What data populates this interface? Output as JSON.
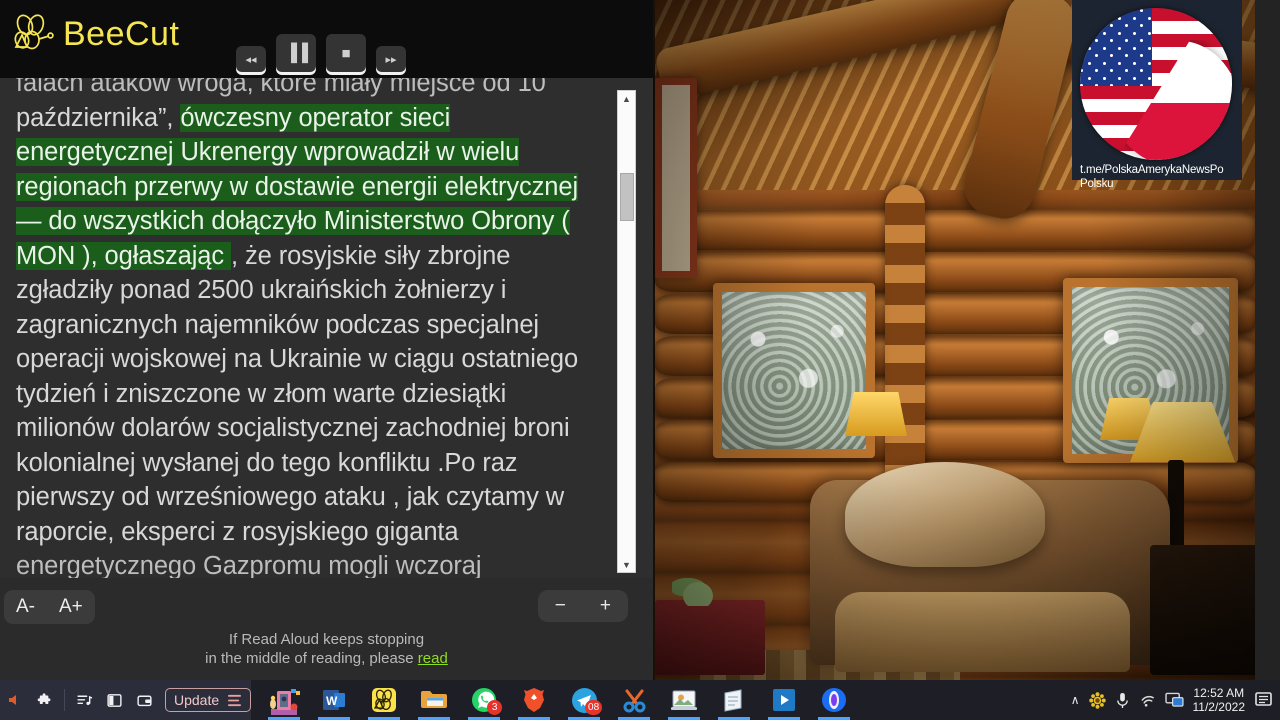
{
  "app": {
    "name": "BeeCut",
    "logo_color": "#f6e552",
    "panel_bg": "#2b2b2b"
  },
  "media_controls": [
    {
      "name": "rewind",
      "glyph": "◂◂",
      "size": "small"
    },
    {
      "name": "pause",
      "glyph": "▐▐",
      "size": "big"
    },
    {
      "name": "stop",
      "glyph": "■",
      "size": "big"
    },
    {
      "name": "forward",
      "glyph": "▸▸",
      "size": "small"
    }
  ],
  "reader": {
    "highlight_color": "#1b5e1b",
    "lines": [
      {
        "text": "falach ataków wroga, które miały miejsce od 10",
        "highlight": "none",
        "clipped": true
      },
      {
        "text": "października”, ",
        "highlight": "none",
        "tail": "ówczesny operator sieci",
        "tail_highlight": "full"
      },
      {
        "text": "energetycznej Ukrenergy wprowadził w wielu",
        "highlight": "full"
      },
      {
        "text": "regionach przerwy w dostawie energii elektrycznej",
        "highlight": "full"
      },
      {
        "text": "— do wszystkich dołączyło Ministerstwo Obrony (",
        "highlight": "full"
      },
      {
        "text": "MON ), ogłaszając ",
        "highlight": "partial",
        "tail": ", że rosyjskie siły zbrojne"
      },
      {
        "text": "zgładziły ponad 2500 ukraińskich żołnierzy i",
        "highlight": "none"
      },
      {
        "text": "zagranicznych najemników podczas specjalnej",
        "highlight": "none"
      },
      {
        "text": "operacji wojskowej na Ukrainie w ciągu ostatniego",
        "highlight": "none"
      },
      {
        "text": "tydzień i zniszczone w złom warte dziesiątki",
        "highlight": "none"
      },
      {
        "text": "milionów dolarów socjalistycznej zachodniej broni",
        "highlight": "none"
      },
      {
        "text": "kolonialnej wysłanej do tego konfliktu .Po raz",
        "highlight": "none"
      },
      {
        "text": "pierwszy od wrześniowego ataku , jak czytamy w",
        "highlight": "none"
      },
      {
        "text": "raporcie, eksperci z rosyjskiego giganta",
        "highlight": "none"
      },
      {
        "text": "energetycznego Gazpromu mogli wczoraj",
        "highlight": "none",
        "clipped": true
      }
    ]
  },
  "controls": {
    "font_decrease": "A-",
    "font_increase": "A+",
    "zoom_out": "−",
    "zoom_in": "+"
  },
  "hint": {
    "line1": "If Read Aloud keeps stopping",
    "line2": "in the middle of reading, please ",
    "link": "read",
    "link_color": "#8fdc22"
  },
  "channel_badge": {
    "line1": "t.me/PolskaAmerykaNewsPo",
    "line2": "Polsku",
    "flags": [
      "us-flag-icon",
      "poland-flag-icon"
    ]
  },
  "taskbar": {
    "browser_icons": [
      {
        "name": "extensions-puzzle-icon",
        "glyph": "✦"
      },
      {
        "name": "playlist-icon",
        "glyph": "♫"
      },
      {
        "name": "sidebar-panel-icon",
        "glyph": "▧"
      },
      {
        "name": "wallet-icon",
        "glyph": "▤"
      }
    ],
    "update_button": {
      "label": "Update",
      "menu_icon": "hamburger-menu-icon"
    },
    "apps": [
      {
        "name": "photos-app",
        "label": "Photos",
        "badge": ""
      },
      {
        "name": "word-app",
        "label": "W",
        "badge": ""
      },
      {
        "name": "beecut-app",
        "label": "BeeCut",
        "badge": ""
      },
      {
        "name": "file-explorer-app",
        "label": "Explorer",
        "badge": ""
      },
      {
        "name": "whatsapp-app",
        "label": "WhatsApp",
        "badge": "3"
      },
      {
        "name": "brave-app",
        "label": "Brave",
        "badge": ""
      },
      {
        "name": "telegram-app",
        "label": "Telegram",
        "badge": "08"
      },
      {
        "name": "snipping-tool-app",
        "label": "Snip",
        "badge": ""
      },
      {
        "name": "image-viewer-app",
        "label": "Viewer",
        "badge": ""
      },
      {
        "name": "notepad-app",
        "label": "Notes",
        "badge": ""
      },
      {
        "name": "media-player-app",
        "label": "Player",
        "badge": ""
      },
      {
        "name": "opera-app",
        "label": "Opera",
        "badge": ""
      }
    ],
    "systray": {
      "chevron": "∧",
      "icons": [
        "sunflower-icon",
        "microphone-icon",
        "wifi-icon",
        "display-cast-icon"
      ],
      "time": "12:52 AM",
      "date": "11/2/2022",
      "notification_icon": "notification-bell-icon"
    }
  }
}
